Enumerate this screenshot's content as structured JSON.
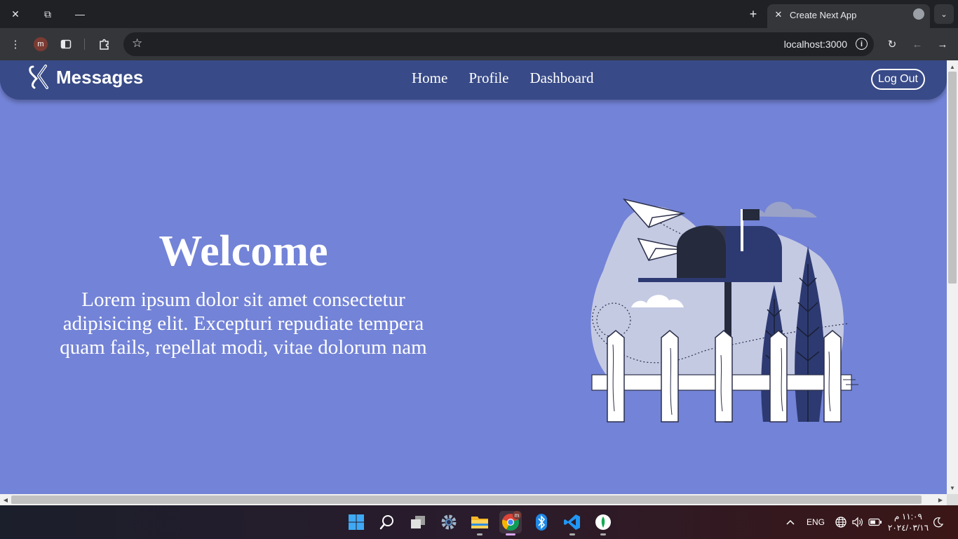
{
  "browser": {
    "tab_title": "Create Next App",
    "tab_close_icon": "✕",
    "url": "localhost:3000",
    "profile_initial": "m",
    "window_close": "✕",
    "window_restore": "⧉",
    "window_minimize": "—",
    "new_tab": "+",
    "tab_list": "⌄",
    "menu": "⋮",
    "star": "☆",
    "info": "i",
    "reload": "↻",
    "back": "←",
    "forward": "→"
  },
  "navbar": {
    "brand": "Messages",
    "links": [
      "Home",
      "Profile",
      "Dashboard"
    ],
    "logout": "Log Out",
    "bg_color": "#384a87"
  },
  "hero": {
    "title": "Welcome",
    "body": "Lorem ipsum dolor sit amet consectetur adipisicing elit. Excepturi repudiate tempera quam fails, repellat modi, vitae dolorum nam",
    "bg_color": "#7383d7"
  },
  "taskbar": {
    "language": "ENG",
    "time": "١١:٠٩ م",
    "date": "٢٠٢٤/٠٣/١٦",
    "chrome_badge": "m"
  }
}
